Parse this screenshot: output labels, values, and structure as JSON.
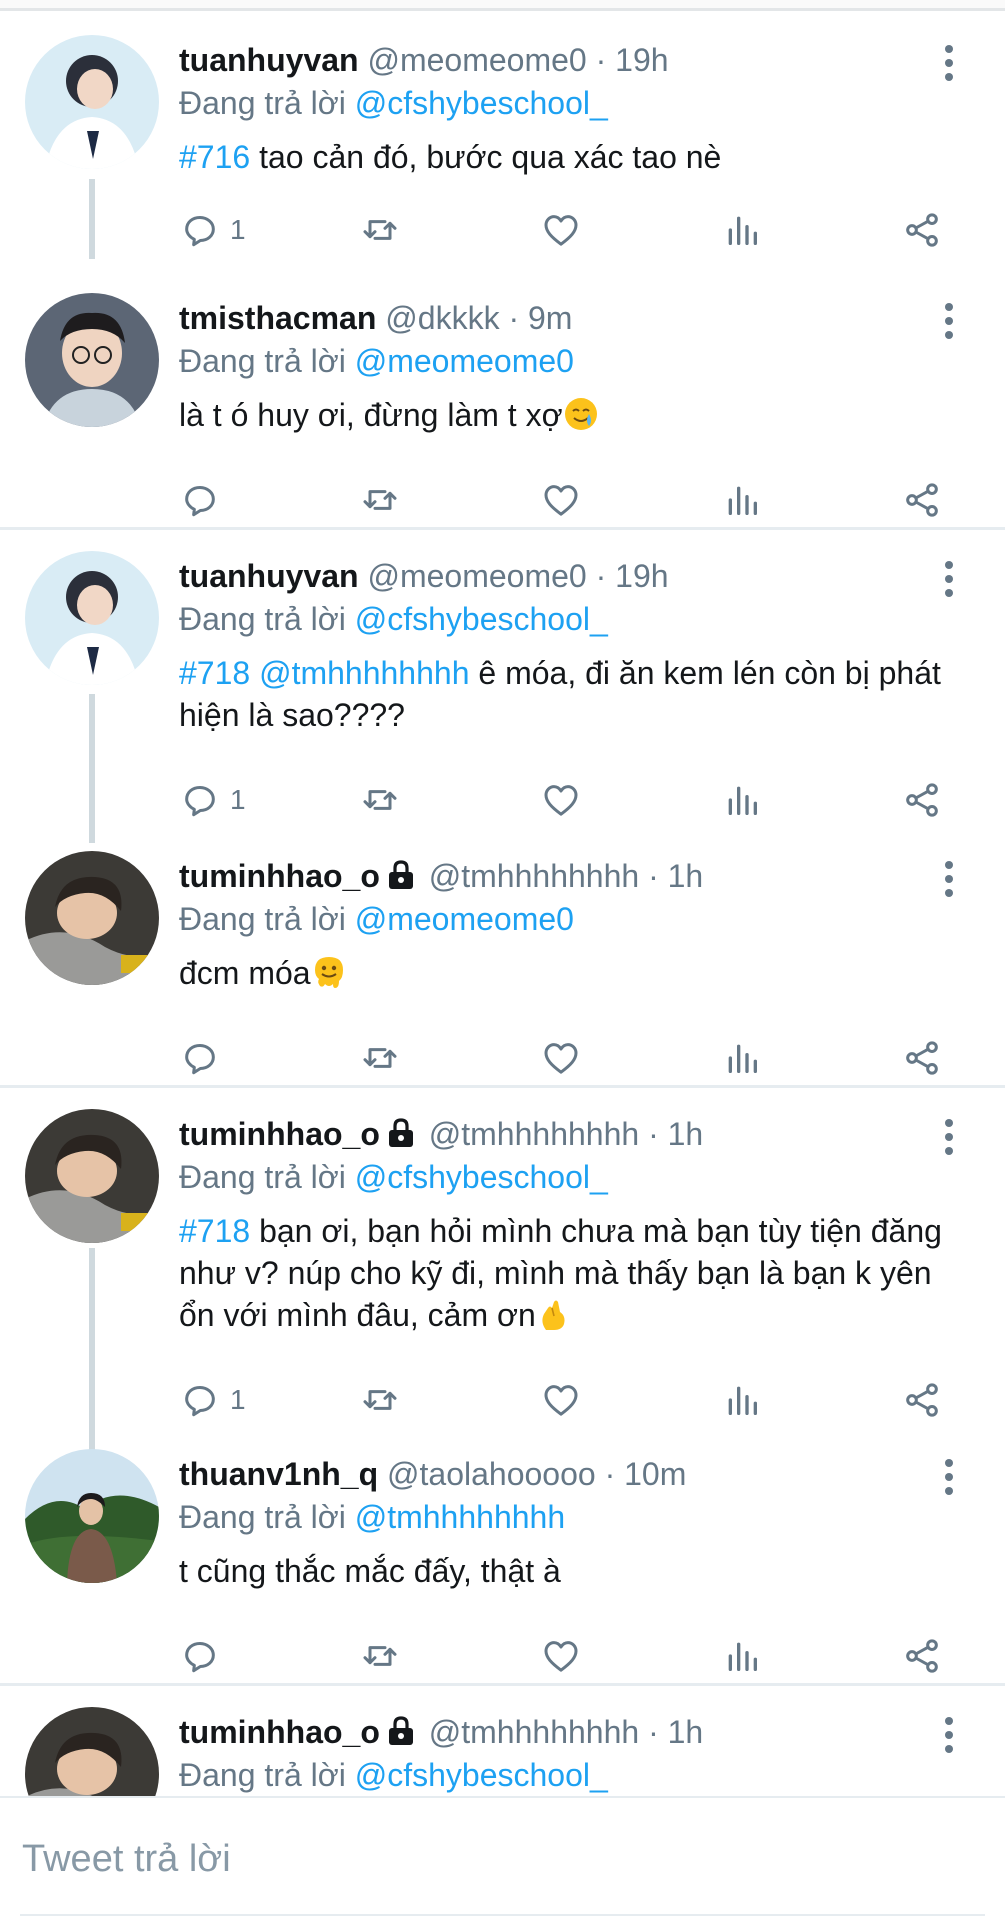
{
  "tweets": [
    {
      "name": "tuanhuyvan",
      "handle": "@meomeome0",
      "dot": "·",
      "time": "19h",
      "replying_label": "Đang trả lời",
      "replying_to": "@cfshybeschool_",
      "hashtag": "#716",
      "mention": "",
      "text": " tao cản đó, bước qua xác tao nè",
      "reply_count": "1",
      "locked": false
    },
    {
      "name": "tmisthacman",
      "handle": "@dkkkk",
      "dot": "·",
      "time": "9m",
      "replying_label": "Đang trả lời",
      "replying_to": "@meomeome0",
      "hashtag": "",
      "mention": "",
      "text": "là t ó huy ơi, đừng làm t xợ",
      "emoji": "crying-smile-emoji",
      "reply_count": "",
      "locked": false
    },
    {
      "name": "tuanhuyvan",
      "handle": "@meomeome0",
      "dot": "·",
      "time": "19h",
      "replying_label": "Đang trả lời",
      "replying_to": "@cfshybeschool_",
      "hashtag": "#718",
      "mention": " @tmhhhhhhhh",
      "text": " ê móa, đi ăn kem lén còn bị phát hiện là sao????",
      "reply_count": "1",
      "locked": false
    },
    {
      "name": "tuminhhao_o",
      "handle": "@tmhhhhhhhh",
      "dot": "·",
      "time": "1h",
      "replying_label": "Đang trả lời",
      "replying_to": "@meomeome0",
      "hashtag": "",
      "mention": "",
      "text": "đcm móa",
      "emoji": "melting-face-emoji",
      "reply_count": "",
      "locked": true
    },
    {
      "name": "tuminhhao_o",
      "handle": "@tmhhhhhhhh",
      "dot": "·",
      "time": "1h",
      "replying_label": "Đang trả lời",
      "replying_to": "@cfshybeschool_",
      "hashtag": "#718",
      "mention": "",
      "text": " bạn ơi, bạn hỏi mình chưa mà bạn tùy tiện đăng như v? núp cho kỹ đi, mình mà thấy bạn là bạn k yên ổn với mình đâu, cảm ơn",
      "emoji": "finger-heart-emoji",
      "reply_count": "1",
      "locked": true
    },
    {
      "name": "thuanv1nh_q",
      "handle": "@taolahooooo",
      "dot": "·",
      "time": "10m",
      "replying_label": "Đang trả lời",
      "replying_to": "@tmhhhhhhhh",
      "hashtag": "",
      "mention": "",
      "text": "t cũng thắc mắc đấy, thật à",
      "reply_count": "",
      "locked": false
    },
    {
      "name": "tuminhhao_o",
      "handle": "@tmhhhhhhhh",
      "dot": "·",
      "time": "1h",
      "replying_label": "Đang trả lời",
      "replying_to": "@cfshybeschool_",
      "hashtag": "",
      "mention": "",
      "text": "",
      "reply_count": "",
      "locked": true
    }
  ],
  "composer": {
    "placeholder": "Tweet trả lời"
  },
  "colors": {
    "link": "#1da1f2",
    "secondary": "#657786",
    "thread_line": "#cfd9de",
    "divider": "#e6ecf0"
  },
  "icons": [
    "reply-icon",
    "retweet-icon",
    "like-icon",
    "analytics-icon",
    "share-icon",
    "more-icon",
    "lock-icon"
  ]
}
